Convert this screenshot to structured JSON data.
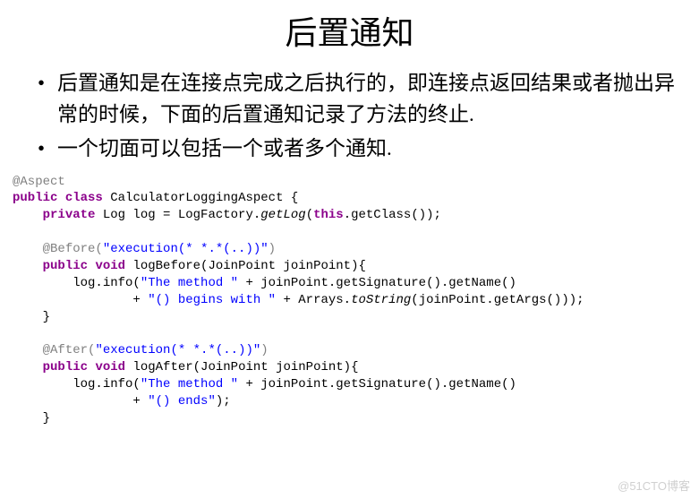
{
  "title": "后置通知",
  "bullets": [
    "后置通知是在连接点完成之后执行的，即连接点返回结果或者抛出异常的时候，下面的后置通知记录了方法的终止.",
    "一个切面可以包括一个或者多个通知."
  ],
  "code": {
    "ann_aspect": "@Aspect",
    "kw_public": "public",
    "kw_class": "class",
    "cls_name": " CalculatorLoggingAspect {",
    "kw_private": "private",
    "log_decl_1": " Log log = LogFactory.",
    "log_decl_getlog": "getLog",
    "log_decl_2": "(",
    "kw_this": "this",
    "log_decl_3": ".getClass());",
    "ann_before": "@Before",
    "before_expr_1": "(",
    "before_str": "\"execution(* *.*(..))\"",
    "before_expr_2": ")",
    "kw_void": "void",
    "logbefore_sig": " logBefore(JoinPoint joinPoint){",
    "logbefore_body1_a": "        log.info(",
    "logbefore_str1": "\"The method \"",
    "logbefore_body1_b": " + joinPoint.getSignature().getName()",
    "logbefore_body2_a": "                + ",
    "logbefore_str2": "\"() begins with \"",
    "logbefore_body2_b": " + Arrays.",
    "logbefore_tostring": "toString",
    "logbefore_body2_c": "(joinPoint.getArgs()));",
    "close_brace": "    }",
    "ann_after": "@After",
    "after_expr_1": "(",
    "after_str": "\"execution(* *.*(..))\"",
    "after_expr_2": ")",
    "logafter_sig": " logAfter(JoinPoint joinPoint){",
    "logafter_body1_a": "        log.info(",
    "logafter_str1": "\"The method \"",
    "logafter_body1_b": " + joinPoint.getSignature().getName()",
    "logafter_body2_a": "                + ",
    "logafter_str2": "\"() ends\"",
    "logafter_body2_b": ");"
  },
  "watermark": "@51CTO博客"
}
